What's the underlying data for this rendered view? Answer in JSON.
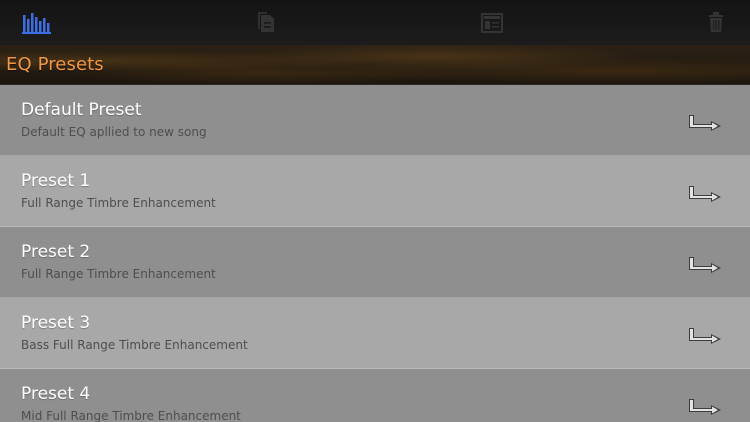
{
  "toolbar": {
    "icons": {
      "eq": "bar-chart-icon",
      "copy": "copy-icon",
      "layout": "window-icon",
      "trash": "trash-icon"
    }
  },
  "header": {
    "title": "EQ Presets"
  },
  "presets": [
    {
      "title": "Default Preset",
      "subtitle": "Default EQ apllied to new song"
    },
    {
      "title": "Preset 1",
      "subtitle": "Full Range Timbre Enhancement"
    },
    {
      "title": "Preset 2",
      "subtitle": "Full Range Timbre Enhancement"
    },
    {
      "title": "Preset 3",
      "subtitle": "Bass Full Range Timbre Enhancement"
    },
    {
      "title": "Preset 4",
      "subtitle": "Mid Full Range Timbre Enhancement"
    }
  ],
  "colors": {
    "toolbar": "#141414",
    "header_text": "#f29844",
    "row_dark": "#8f8f8f",
    "row_light": "#a8a8a8",
    "row_title": "#ffffff",
    "row_subtitle": "#4e4e4e",
    "eq_icon": "#3b6ee3",
    "inactive_icon": "#343434"
  }
}
